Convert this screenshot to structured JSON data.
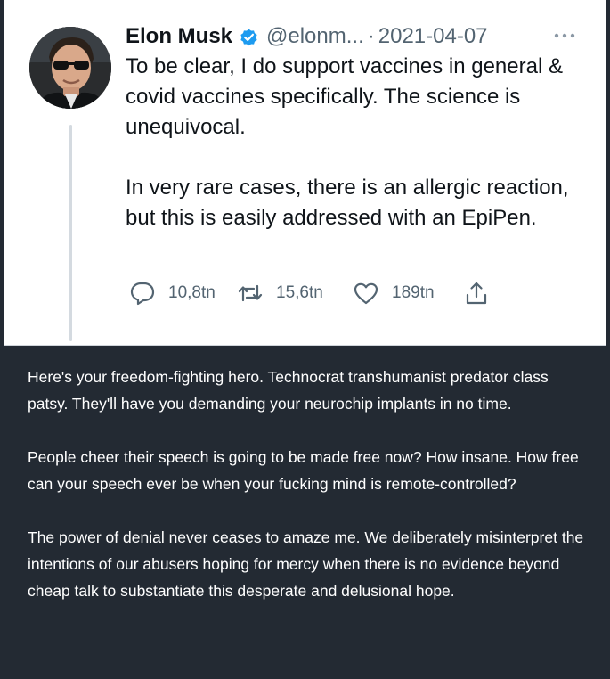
{
  "tweet": {
    "author_name": "Elon Musk",
    "handle": "@elonm...",
    "separator": "·",
    "date": "2021-04-07",
    "paragraphs": [
      "To be clear, I do support vaccines in general & covid vaccines specifically. The science is unequivocal.",
      "In very rare cases, there is an allergic reaction, but this is easily addressed with an EpiPen."
    ],
    "actions": {
      "replies": "10,8tn",
      "retweets": "15,6tn",
      "likes": "189tn"
    },
    "icons": {
      "avatar": "avatar-photo",
      "verified": "verified-badge-icon",
      "more": "more-options-icon",
      "reply": "reply-icon",
      "retweet": "retweet-icon",
      "like": "heart-icon",
      "share": "share-icon"
    }
  },
  "comment": {
    "paragraphs": [
      "Here's your freedom-fighting hero. Technocrat transhumanist predator class patsy. They'll have you demanding your neurochip implants in no time.",
      "People cheer their speech is going to be made free now? How insane. How free can your speech ever be when your fucking mind is remote-controlled?",
      "The power of denial never ceases to amaze me. We deliberately misinterpret the intentions of our abusers hoping for mercy when there is no evidence beyond cheap talk to substantiate this desperate and delusional hope."
    ]
  },
  "colors": {
    "background": "#232a33",
    "tweet_background": "#ffffff",
    "verified_blue": "#1d9bf0",
    "secondary_text": "#536471",
    "primary_text": "#0f1419",
    "comment_text": "#ffffff"
  }
}
